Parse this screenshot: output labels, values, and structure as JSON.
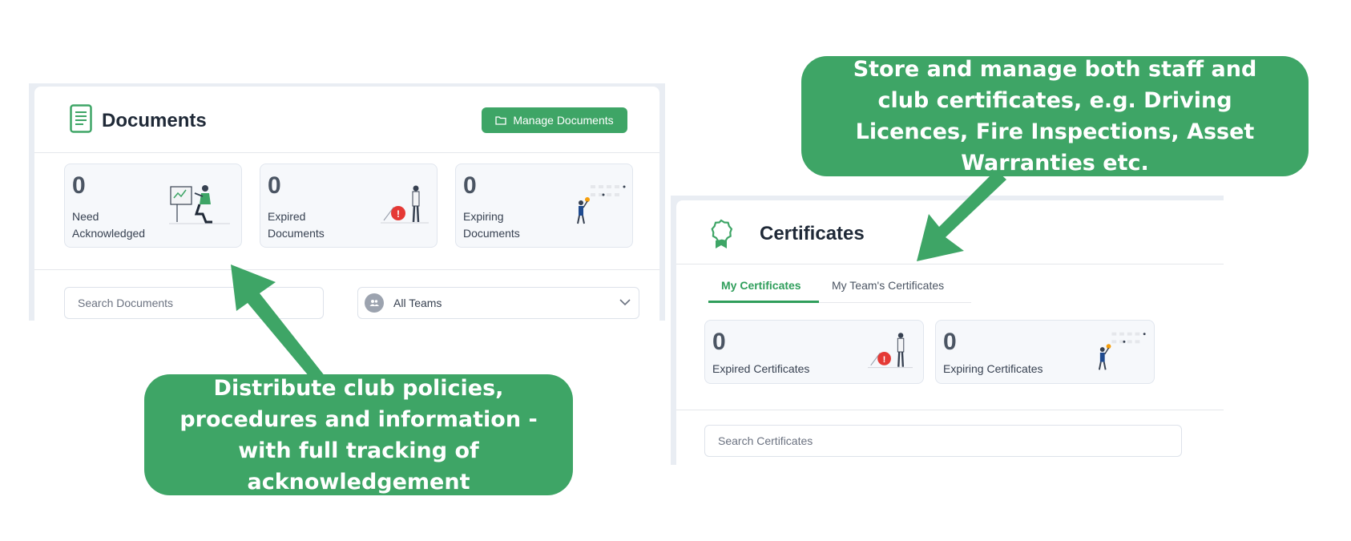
{
  "documents": {
    "title": "Documents",
    "manage_button": "Manage Documents",
    "stats": [
      {
        "value": "0",
        "label": "Need Acknowledged",
        "illustration": "person-signing-board-icon"
      },
      {
        "value": "0",
        "label": "Expired Documents",
        "illustration": "expired-alert-icon"
      },
      {
        "value": "0",
        "label": "Expiring Documents",
        "illustration": "person-calendar-icon"
      }
    ],
    "search_placeholder": "Search Documents",
    "team_filter": {
      "selected": "All Teams"
    }
  },
  "certificates": {
    "title": "Certificates",
    "tabs": [
      {
        "label": "My Certificates",
        "active": true
      },
      {
        "label": "My Team's Certificates",
        "active": false
      }
    ],
    "stats": [
      {
        "value": "0",
        "label": "Expired Certificates",
        "illustration": "expired-alert-icon"
      },
      {
        "value": "0",
        "label": "Expiring Certificates",
        "illustration": "person-calendar-icon"
      }
    ],
    "search_placeholder": "Search Certificates"
  },
  "callouts": {
    "certificates": "Store and manage both staff and club certificates, e.g. Driving Licences, Fire Inspections, Asset Warranties etc.",
    "documents": "Distribute club policies, procedures and information - with full tracking of acknowledgement"
  },
  "colors": {
    "brand_green": "#3ea566",
    "active_tab_green": "#2f9e5b",
    "alert_red": "#e53935"
  }
}
